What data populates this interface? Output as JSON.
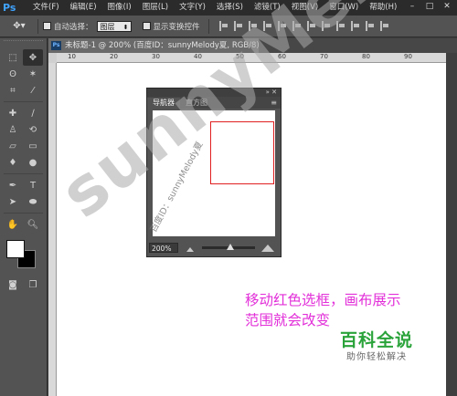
{
  "app": {
    "logo": "Ps"
  },
  "menu": [
    "文件(F)",
    "编辑(E)",
    "图像(I)",
    "图层(L)",
    "文字(Y)",
    "选择(S)",
    "滤镜(T)",
    "视图(V)",
    "窗口(W)",
    "帮助(H)"
  ],
  "window_controls": {
    "minimize": "–",
    "maximize": "□",
    "close": "✕"
  },
  "options": {
    "tool_icon": "move-tool-icon",
    "auto_select_label": "自动选择：",
    "auto_select_value": "图层",
    "show_transform_label": "显示变换控件"
  },
  "document": {
    "tab_title": "未标题-1 @ 200% (百度ID：sunnyMelody夏, RGB/8) *"
  },
  "ruler": {
    "top_labels": [
      "10",
      "20",
      "30",
      "40",
      "50",
      "60",
      "70",
      "80",
      "90"
    ]
  },
  "toolbox": {
    "tools": [
      "marquee-tool-icon",
      "move-tool-icon",
      "lasso-tool-icon",
      "magic-wand-icon",
      "crop-tool-icon",
      "eyedropper-icon",
      "healing-brush-icon",
      "brush-tool-icon",
      "clone-stamp-icon",
      "history-brush-icon",
      "eraser-icon",
      "gradient-icon",
      "blur-icon",
      "dodge-icon",
      "pen-tool-icon",
      "text-tool-icon",
      "path-select-icon",
      "ellipse-tool-icon",
      "hand-tool-icon",
      "zoom-tool-icon"
    ],
    "foreground_color": "#ffffff",
    "background_color": "#000000"
  },
  "navigator": {
    "tab_navigator": "导航器",
    "tab_histogram": "直方图",
    "collapse": "»",
    "close": "✕",
    "menu": "≡",
    "zoom": "200%"
  },
  "annotation": {
    "line1": "移动红色选框，画布展示",
    "line2": "范围就会改变"
  },
  "badge": {
    "title": "百科全说",
    "subtitle": "助你轻松解决"
  },
  "watermark": {
    "big": "sunnyMelody夏",
    "small": "百度ID：sunnyMelody夏"
  },
  "colors": {
    "annotation_magenta": "#e22fd9",
    "selection_red": "#e02020",
    "badge_green": "#2aa33a"
  }
}
